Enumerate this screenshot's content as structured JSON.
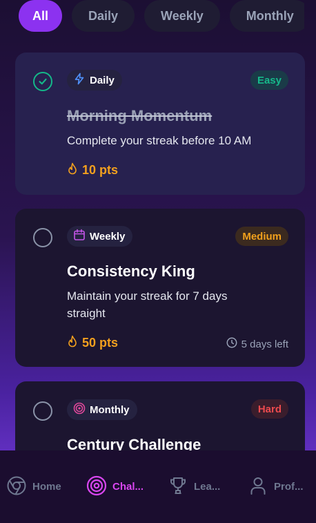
{
  "filters": [
    {
      "label": "All",
      "active": true
    },
    {
      "label": "Daily",
      "active": false
    },
    {
      "label": "Weekly",
      "active": false
    },
    {
      "label": "Monthly",
      "active": false
    }
  ],
  "challenges": [
    {
      "type": "Daily",
      "type_icon": "lightning-icon",
      "difficulty": "Easy",
      "title": "Morning Momentum",
      "description": "Complete your streak before 10 AM",
      "points": "10 pts",
      "completed": true
    },
    {
      "type": "Weekly",
      "type_icon": "calendar-icon",
      "difficulty": "Medium",
      "title": "Consistency King",
      "description": "Maintain your streak for 7 days straight",
      "points": "50 pts",
      "time_left": "5 days left",
      "completed": false
    },
    {
      "type": "Monthly",
      "type_icon": "target-icon",
      "difficulty": "Hard",
      "title": "Century Challenge",
      "completed": false
    }
  ],
  "nav": [
    {
      "label": "Home",
      "icon": "chrome-icon",
      "active": false
    },
    {
      "label": "Chal...",
      "icon": "target-icon",
      "active": true
    },
    {
      "label": "Lea...",
      "icon": "trophy-icon",
      "active": false
    },
    {
      "label": "Prof...",
      "icon": "user-icon",
      "active": false
    }
  ],
  "colors": {
    "accent": "#8c32f0",
    "active_nav": "#d946ef",
    "points": "#f3a01e",
    "easy": "#16b98a",
    "medium": "#f0a01c",
    "hard": "#ec4a4e",
    "check_done": "#14b889"
  }
}
